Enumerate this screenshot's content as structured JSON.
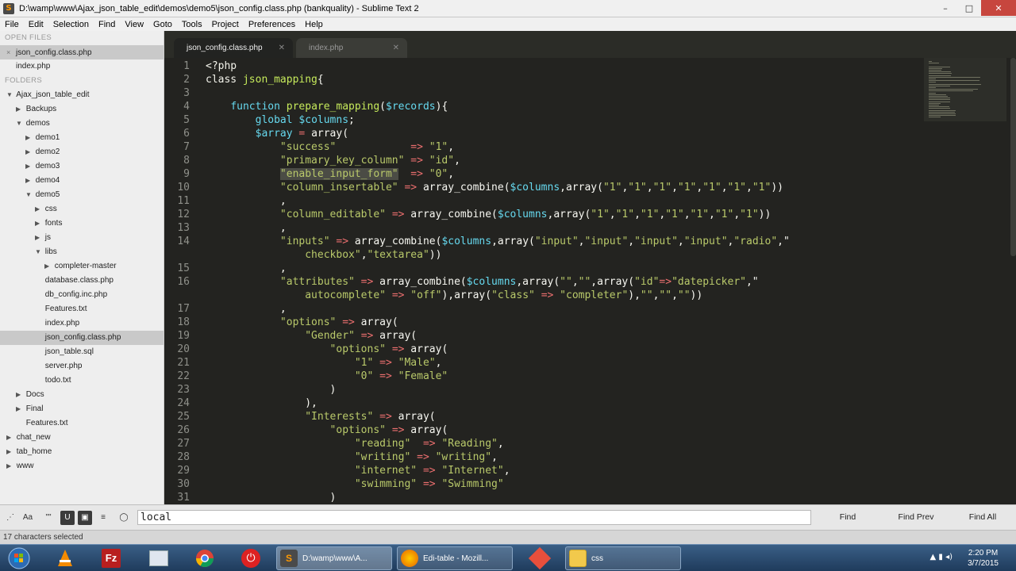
{
  "window": {
    "title": "D:\\wamp\\www\\Ajax_json_table_edit\\demos\\demo5\\json_config.class.php (bankquality) - Sublime Text 2",
    "minimize": "–",
    "maximize": "□",
    "close": "✕"
  },
  "menu": [
    "File",
    "Edit",
    "Selection",
    "Find",
    "View",
    "Goto",
    "Tools",
    "Project",
    "Preferences",
    "Help"
  ],
  "sidebar": {
    "open_files_label": "OPEN FILES",
    "open_files": [
      {
        "name": "json_config.class.php",
        "active": true
      },
      {
        "name": "index.php",
        "active": false
      }
    ],
    "folders_label": "FOLDERS",
    "tree": [
      {
        "name": "Ajax_json_table_edit",
        "arrow": "▼",
        "level": 0
      },
      {
        "name": "Backups",
        "arrow": "▶",
        "level": 1
      },
      {
        "name": "demos",
        "arrow": "▼",
        "level": 1
      },
      {
        "name": "demo1",
        "arrow": "▶",
        "level": 2
      },
      {
        "name": "demo2",
        "arrow": "▶",
        "level": 2
      },
      {
        "name": "demo3",
        "arrow": "▶",
        "level": 2
      },
      {
        "name": "demo4",
        "arrow": "▶",
        "level": 2
      },
      {
        "name": "demo5",
        "arrow": "▼",
        "level": 2
      },
      {
        "name": "css",
        "arrow": "▶",
        "level": 3
      },
      {
        "name": "fonts",
        "arrow": "▶",
        "level": 3
      },
      {
        "name": "js",
        "arrow": "▶",
        "level": 3
      },
      {
        "name": "libs",
        "arrow": "▼",
        "level": 3
      },
      {
        "name": "completer-master",
        "arrow": "▶",
        "level": 4
      },
      {
        "name": "database.class.php",
        "arrow": "",
        "level": 3
      },
      {
        "name": "db_config.inc.php",
        "arrow": "",
        "level": 3
      },
      {
        "name": "Features.txt",
        "arrow": "",
        "level": 3
      },
      {
        "name": "index.php",
        "arrow": "",
        "level": 3
      },
      {
        "name": "json_config.class.php",
        "arrow": "",
        "level": 3,
        "selected": true
      },
      {
        "name": "json_table.sql",
        "arrow": "",
        "level": 3
      },
      {
        "name": "server.php",
        "arrow": "",
        "level": 3
      },
      {
        "name": "todo.txt",
        "arrow": "",
        "level": 3
      },
      {
        "name": "Docs",
        "arrow": "▶",
        "level": 1
      },
      {
        "name": "Final",
        "arrow": "▶",
        "level": 1
      },
      {
        "name": "Features.txt",
        "arrow": "",
        "level": 1
      },
      {
        "name": "chat_new",
        "arrow": "▶",
        "level": 0
      },
      {
        "name": "tab_home",
        "arrow": "▶",
        "level": 0
      },
      {
        "name": "www",
        "arrow": "▶",
        "level": 0
      }
    ]
  },
  "tabs": [
    {
      "label": "json_config.class.php",
      "close": "✕",
      "active": true
    },
    {
      "label": "index.php",
      "close": "✕",
      "active": false
    }
  ],
  "editor": {
    "lines": [
      {
        "n": "1",
        "tokens": [
          [
            "kw",
            "<?php"
          ]
        ]
      },
      {
        "n": "2",
        "tokens": [
          [
            "kw",
            "class "
          ],
          [
            "fn",
            "json_mapping"
          ],
          [
            "plain",
            "{"
          ]
        ]
      },
      {
        "n": "3",
        "tokens": []
      },
      {
        "n": "4",
        "tokens": [
          [
            "plain",
            "    "
          ],
          [
            "var",
            "function "
          ],
          [
            "fn",
            "prepare_mapping"
          ],
          [
            "plain",
            "("
          ],
          [
            "var",
            "$records"
          ],
          [
            "plain",
            "){"
          ]
        ]
      },
      {
        "n": "5",
        "tokens": [
          [
            "plain",
            "        "
          ],
          [
            "var",
            "global "
          ],
          [
            "var",
            "$columns"
          ],
          [
            "plain",
            ";"
          ]
        ]
      },
      {
        "n": "6",
        "tokens": [
          [
            "plain",
            "        "
          ],
          [
            "var",
            "$array"
          ],
          [
            "op",
            " = "
          ],
          [
            "plain",
            "array("
          ]
        ]
      },
      {
        "n": "7",
        "tokens": [
          [
            "plain",
            "            "
          ],
          [
            "str",
            "\"success\""
          ],
          [
            "plain",
            "            "
          ],
          [
            "op",
            "=>"
          ],
          [
            "plain",
            " "
          ],
          [
            "str",
            "\"1\""
          ],
          [
            "plain",
            ","
          ]
        ]
      },
      {
        "n": "8",
        "tokens": [
          [
            "plain",
            "            "
          ],
          [
            "str",
            "\"primary_key_column\""
          ],
          [
            "plain",
            " "
          ],
          [
            "op",
            "=>"
          ],
          [
            "plain",
            " "
          ],
          [
            "str",
            "\"id\""
          ],
          [
            "plain",
            ","
          ]
        ]
      },
      {
        "n": "9",
        "tokens": [
          [
            "plain",
            "            "
          ],
          [
            "str",
            "\"enable_input_form\""
          ],
          [
            "plain",
            "  "
          ],
          [
            "op",
            "=>"
          ],
          [
            "plain",
            " "
          ],
          [
            "str",
            "\"0\""
          ],
          [
            "plain",
            ","
          ]
        ]
      },
      {
        "n": "10",
        "tokens": [
          [
            "plain",
            "            "
          ],
          [
            "str",
            "\"column_insertable\""
          ],
          [
            "plain",
            " "
          ],
          [
            "op",
            "=>"
          ],
          [
            "plain",
            " array_combine("
          ],
          [
            "var",
            "$columns"
          ],
          [
            "plain",
            ",array("
          ],
          [
            "str",
            "\"1\""
          ],
          [
            "plain",
            ","
          ],
          [
            "str",
            "\"1\""
          ],
          [
            "plain",
            ","
          ],
          [
            "str",
            "\"1\""
          ],
          [
            "plain",
            ","
          ],
          [
            "str",
            "\"1\""
          ],
          [
            "plain",
            ","
          ],
          [
            "str",
            "\"1\""
          ],
          [
            "plain",
            ","
          ],
          [
            "str",
            "\"1\""
          ],
          [
            "plain",
            ","
          ],
          [
            "str",
            "\"1\""
          ],
          [
            "plain",
            "))"
          ]
        ]
      },
      {
        "n": "11",
        "tokens": [
          [
            "plain",
            "            ,"
          ]
        ]
      },
      {
        "n": "12",
        "tokens": [
          [
            "plain",
            "            "
          ],
          [
            "str",
            "\"column_editable\""
          ],
          [
            "plain",
            " "
          ],
          [
            "op",
            "=>"
          ],
          [
            "plain",
            " array_combine("
          ],
          [
            "var",
            "$columns"
          ],
          [
            "plain",
            ",array("
          ],
          [
            "str",
            "\"1\""
          ],
          [
            "plain",
            ","
          ],
          [
            "str",
            "\"1\""
          ],
          [
            "plain",
            ","
          ],
          [
            "str",
            "\"1\""
          ],
          [
            "plain",
            ","
          ],
          [
            "str",
            "\"1\""
          ],
          [
            "plain",
            ","
          ],
          [
            "str",
            "\"1\""
          ],
          [
            "plain",
            ","
          ],
          [
            "str",
            "\"1\""
          ],
          [
            "plain",
            ","
          ],
          [
            "str",
            "\"1\""
          ],
          [
            "plain",
            "))"
          ]
        ]
      },
      {
        "n": "13",
        "tokens": [
          [
            "plain",
            "            ,"
          ]
        ]
      },
      {
        "n": "14",
        "tokens": [
          [
            "plain",
            "            "
          ],
          [
            "str",
            "\"inputs\""
          ],
          [
            "plain",
            " "
          ],
          [
            "op",
            "=>"
          ],
          [
            "plain",
            " array_combine("
          ],
          [
            "var",
            "$columns"
          ],
          [
            "plain",
            ",array("
          ],
          [
            "str",
            "\"input\""
          ],
          [
            "plain",
            ","
          ],
          [
            "str",
            "\"input\""
          ],
          [
            "plain",
            ","
          ],
          [
            "str",
            "\"input\""
          ],
          [
            "plain",
            ","
          ],
          [
            "str",
            "\"input\""
          ],
          [
            "plain",
            ","
          ],
          [
            "str",
            "\"radio\""
          ],
          [
            "plain",
            ",\""
          ]
        ]
      },
      {
        "n": "",
        "tokens": [
          [
            "plain",
            "                "
          ],
          [
            "str",
            "checkbox\""
          ],
          [
            "plain",
            ","
          ],
          [
            "str",
            "\"textarea\""
          ],
          [
            "plain",
            "))"
          ]
        ]
      },
      {
        "n": "15",
        "tokens": [
          [
            "plain",
            "            ,"
          ]
        ]
      },
      {
        "n": "16",
        "tokens": [
          [
            "plain",
            "            "
          ],
          [
            "str",
            "\"attributes\""
          ],
          [
            "plain",
            " "
          ],
          [
            "op",
            "=>"
          ],
          [
            "plain",
            " array_combine("
          ],
          [
            "var",
            "$columns"
          ],
          [
            "plain",
            ",array("
          ],
          [
            "str",
            "\"\""
          ],
          [
            "plain",
            ","
          ],
          [
            "str",
            "\"\""
          ],
          [
            "plain",
            ",array("
          ],
          [
            "str",
            "\"id\""
          ],
          [
            "op",
            "=>"
          ],
          [
            "str",
            "\"datepicker\""
          ],
          [
            "plain",
            ",\""
          ]
        ]
      },
      {
        "n": "",
        "tokens": [
          [
            "plain",
            "                "
          ],
          [
            "str",
            "autocomplete\""
          ],
          [
            "plain",
            " "
          ],
          [
            "op",
            "=>"
          ],
          [
            "plain",
            " "
          ],
          [
            "str",
            "\"off\""
          ],
          [
            "plain",
            "),array("
          ],
          [
            "str",
            "\"class\""
          ],
          [
            "plain",
            " "
          ],
          [
            "op",
            "=>"
          ],
          [
            "plain",
            " "
          ],
          [
            "str",
            "\"completer\""
          ],
          [
            "plain",
            "),"
          ],
          [
            "str",
            "\"\""
          ],
          [
            "plain",
            ","
          ],
          [
            "str",
            "\"\""
          ],
          [
            "plain",
            ","
          ],
          [
            "str",
            "\"\""
          ],
          [
            "plain",
            "))"
          ]
        ]
      },
      {
        "n": "17",
        "tokens": [
          [
            "plain",
            "            ,"
          ]
        ]
      },
      {
        "n": "18",
        "tokens": [
          [
            "plain",
            "            "
          ],
          [
            "str",
            "\"options\""
          ],
          [
            "plain",
            " "
          ],
          [
            "op",
            "=>"
          ],
          [
            "plain",
            " array("
          ]
        ]
      },
      {
        "n": "19",
        "tokens": [
          [
            "plain",
            "                "
          ],
          [
            "str",
            "\"Gender\""
          ],
          [
            "plain",
            " "
          ],
          [
            "op",
            "=>"
          ],
          [
            "plain",
            " array("
          ]
        ]
      },
      {
        "n": "20",
        "tokens": [
          [
            "plain",
            "                    "
          ],
          [
            "str",
            "\"options\""
          ],
          [
            "plain",
            " "
          ],
          [
            "op",
            "=>"
          ],
          [
            "plain",
            " array("
          ]
        ]
      },
      {
        "n": "21",
        "tokens": [
          [
            "plain",
            "                        "
          ],
          [
            "str",
            "\"1\""
          ],
          [
            "plain",
            " "
          ],
          [
            "op",
            "=>"
          ],
          [
            "plain",
            " "
          ],
          [
            "str",
            "\"Male\""
          ],
          [
            "plain",
            ","
          ]
        ]
      },
      {
        "n": "22",
        "tokens": [
          [
            "plain",
            "                        "
          ],
          [
            "str",
            "\"0\""
          ],
          [
            "plain",
            " "
          ],
          [
            "op",
            "=>"
          ],
          [
            "plain",
            " "
          ],
          [
            "str",
            "\"Female\""
          ]
        ]
      },
      {
        "n": "23",
        "tokens": [
          [
            "plain",
            "                    )"
          ]
        ]
      },
      {
        "n": "24",
        "tokens": [
          [
            "plain",
            "                ),"
          ]
        ]
      },
      {
        "n": "25",
        "tokens": [
          [
            "plain",
            "                "
          ],
          [
            "str",
            "\"Interests\""
          ],
          [
            "plain",
            " "
          ],
          [
            "op",
            "=>"
          ],
          [
            "plain",
            " array("
          ]
        ]
      },
      {
        "n": "26",
        "tokens": [
          [
            "plain",
            "                    "
          ],
          [
            "str",
            "\"options\""
          ],
          [
            "plain",
            " "
          ],
          [
            "op",
            "=>"
          ],
          [
            "plain",
            " array("
          ]
        ]
      },
      {
        "n": "27",
        "tokens": [
          [
            "plain",
            "                        "
          ],
          [
            "str",
            "\"reading\""
          ],
          [
            "plain",
            "  "
          ],
          [
            "op",
            "=>"
          ],
          [
            "plain",
            " "
          ],
          [
            "str",
            "\"Reading\""
          ],
          [
            "plain",
            ","
          ]
        ]
      },
      {
        "n": "28",
        "tokens": [
          [
            "plain",
            "                        "
          ],
          [
            "str",
            "\"writing\""
          ],
          [
            "plain",
            " "
          ],
          [
            "op",
            "=>"
          ],
          [
            "plain",
            " "
          ],
          [
            "str",
            "\"writing\""
          ],
          [
            "plain",
            ","
          ]
        ]
      },
      {
        "n": "29",
        "tokens": [
          [
            "plain",
            "                        "
          ],
          [
            "str",
            "\"internet\""
          ],
          [
            "plain",
            " "
          ],
          [
            "op",
            "=>"
          ],
          [
            "plain",
            " "
          ],
          [
            "str",
            "\"Internet\""
          ],
          [
            "plain",
            ","
          ]
        ]
      },
      {
        "n": "30",
        "tokens": [
          [
            "plain",
            "                        "
          ],
          [
            "str",
            "\"swimming\""
          ],
          [
            "plain",
            " "
          ],
          [
            "op",
            "=>"
          ],
          [
            "plain",
            " "
          ],
          [
            "str",
            "\"Swimming\""
          ]
        ]
      },
      {
        "n": "31",
        "tokens": [
          [
            "plain",
            "                    )"
          ]
        ]
      }
    ]
  },
  "find": {
    "options": [
      "Aa",
      "\"\"",
      "U",
      "▣",
      "≡",
      "◯"
    ],
    "value": "local",
    "find_label": "Find",
    "find_prev_label": "Find Prev",
    "find_all_label": "Find All"
  },
  "status": {
    "text": "17 characters selected"
  },
  "taskbar": {
    "sublime_label": "D:\\wamp\\www\\A...",
    "firefox_label": "Edi-table - Mozill...",
    "explorer_label": "css",
    "time": "2:20 PM",
    "date": "3/7/2015"
  }
}
